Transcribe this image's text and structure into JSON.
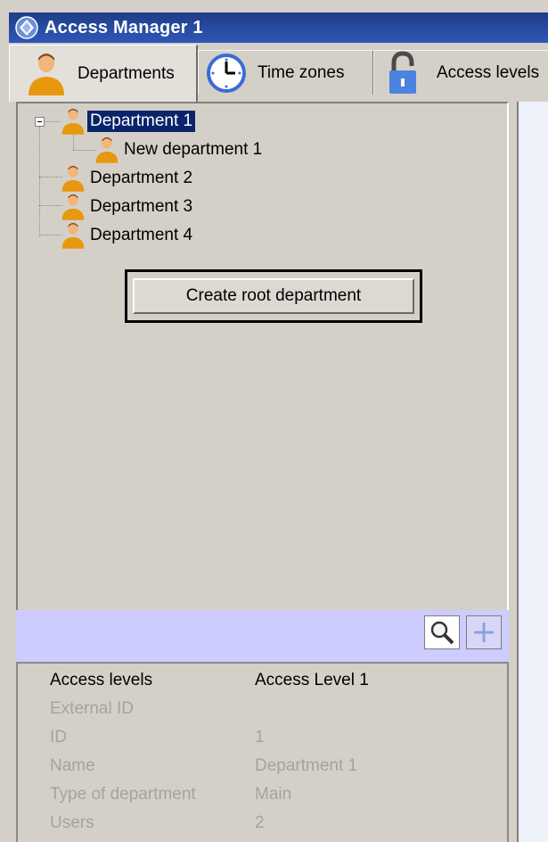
{
  "window": {
    "title": "Access Manager 1",
    "icon": "app-diamond-icon"
  },
  "tabs": [
    {
      "label": "Departments",
      "icon": "user-icon",
      "active": true
    },
    {
      "label": "Time zones",
      "icon": "clock-icon",
      "active": false
    },
    {
      "label": "Access levels",
      "icon": "lock-icon",
      "active": false
    }
  ],
  "tree": {
    "items": [
      {
        "label": "Department 1",
        "selected": true,
        "expanded": true,
        "level": 0
      },
      {
        "label": "New department 1",
        "selected": false,
        "level": 1
      },
      {
        "label": "Department 2",
        "selected": false,
        "level": 0
      },
      {
        "label": "Department 3",
        "selected": false,
        "level": 0
      },
      {
        "label": "Department 4",
        "selected": false,
        "level": 0
      }
    ]
  },
  "create_root_button": {
    "label": "Create root department"
  },
  "toolbar": {
    "search_icon": "search-icon",
    "add_icon": "plus-icon"
  },
  "properties": [
    {
      "name": "Access levels",
      "value": "Access Level 1",
      "enabled": true
    },
    {
      "name": "External ID",
      "value": "",
      "enabled": false
    },
    {
      "name": "ID",
      "value": "1",
      "enabled": false
    },
    {
      "name": "Name",
      "value": "Department 1",
      "enabled": false
    },
    {
      "name": "Type of department",
      "value": "Main",
      "enabled": false
    },
    {
      "name": "Users",
      "value": "2",
      "enabled": false
    }
  ],
  "colors": {
    "title_bar": "#2d57b8",
    "selection": "#0a246a",
    "toolbar_bg": "#ccccff",
    "panel_bg": "#d4d0c8"
  }
}
